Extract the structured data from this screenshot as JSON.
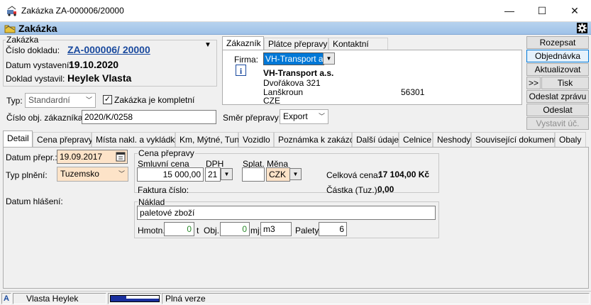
{
  "window": {
    "title": "Zakázka ZA-000006/20000",
    "minimize": "—",
    "maximize": "☐",
    "close": "✕"
  },
  "band": {
    "label": "Zakázka"
  },
  "order": {
    "group_title": "Zakázka",
    "doc_no_label": "Číslo dokladu:",
    "doc_no": "ZA-000006/ 20000",
    "issue_date_label": "Datum vystavení:",
    "issue_date": "19.10.2020",
    "issued_by_label": "Doklad vystavil:",
    "issued_by": "Heylek Vlasta",
    "type_label": "Typ:",
    "type_value": "Standardní",
    "complete_label": "Zakázka je kompletní",
    "customer_order_label": "Číslo obj. zákazníka:",
    "customer_order": "2020/K/0258",
    "direction_label": "Směr přepravy:",
    "direction_value": "Export"
  },
  "customer_tabs": [
    "Zákazník",
    "Plátce přepravy",
    "Kontaktní osoba"
  ],
  "customer": {
    "firm_label": "Firma:",
    "firm_value": "VH-Transport a.s.",
    "name": "VH-Transport a.s.",
    "street": "Dvořákova 321",
    "city": "Lanškroun",
    "zip": "56301",
    "country": "CZE"
  },
  "actions": {
    "split": "Rozepsat",
    "order": "Objednávka",
    "refresh": "Aktualizovat",
    "print_prefix": ">>",
    "print": "Tisk",
    "send_message": "Odeslat zprávu",
    "send_offer": "Odeslat nabídku",
    "invoice": "Vystavit úč."
  },
  "tabs": [
    "Detail",
    "Cena přepravy",
    "Místa nakl. a vykládky",
    "Km, Mýtné, Tuny",
    "Vozidlo",
    "Poznámka k zakázce",
    "Další údaje",
    "Celnice",
    "Neshody",
    "Související dokumenty",
    "Obaly"
  ],
  "detail": {
    "transport_date_label": "Datum přepr.:",
    "transport_date": "19.09.2017",
    "fulfillment_label": "Typ plnění:",
    "fulfillment_value": "Tuzemsko",
    "report_date_label": "Datum hlášení:",
    "price_group_title": "Cena přepravy",
    "contract_price_label": "Smluvní cena",
    "contract_price": "15 000,00",
    "vat_label": "DPH",
    "vat_value": "21",
    "due_label": "Splat.",
    "due_value": "",
    "currency_label": "Měna",
    "currency_value": "CZK",
    "invoice_no_label": "Faktura číslo:",
    "total_price_label": "Celková cena:",
    "total_price": "17 104,00 Kč",
    "amount_label": "Částka (Tuz.):",
    "amount_value": "0,00",
    "cargo_group_title": "Náklad",
    "cargo_desc": "paletové zboží",
    "weight_label": "Hmotn.:",
    "weight_value": "0",
    "weight_unit": "t",
    "volume_label": "Obj.:",
    "volume_value": "0",
    "volume_unit_label": "mj:",
    "volume_unit": "m3",
    "pallets_label": "Palety:",
    "pallets_value": "6"
  },
  "status": {
    "mode": "A",
    "user": "Vlasta Heylek",
    "version": "Plná verze"
  },
  "colors": {
    "link": "#1a4a9e",
    "band": "#a9c9ec",
    "peach": "#fde3c8"
  },
  "icons": {
    "app": "truck-app-icon",
    "band": "folder-icon",
    "settings": "gear-icon",
    "info": "info-icon",
    "dropdown": "chevron-down-icon",
    "calendar": "calendar-icon"
  }
}
